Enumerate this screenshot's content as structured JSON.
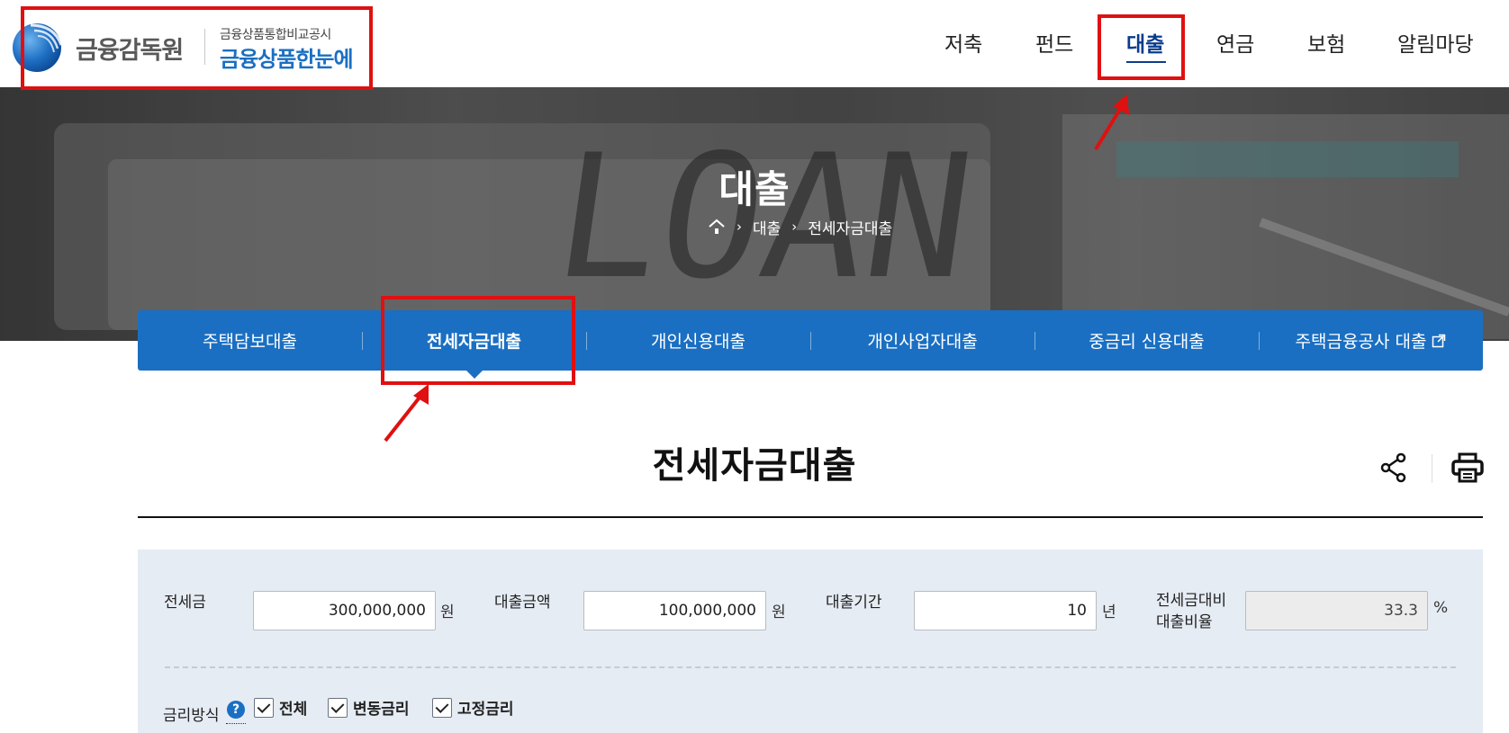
{
  "header": {
    "logo": {
      "org_name": "금융감독원",
      "sub_title": "금융상품통합비교공시",
      "main_title": "금융상품한눈에"
    },
    "nav": [
      {
        "label": "저축",
        "active": false
      },
      {
        "label": "펀드",
        "active": false
      },
      {
        "label": "대출",
        "active": true
      },
      {
        "label": "연금",
        "active": false
      },
      {
        "label": "보험",
        "active": false
      },
      {
        "label": "알림마당",
        "active": false
      }
    ]
  },
  "hero": {
    "title": "대출",
    "breadcrumb": {
      "home_icon": "home-icon",
      "items": [
        "대출",
        "전세자금대출"
      ]
    }
  },
  "subtabs": [
    {
      "label": "주택담보대출",
      "active": false
    },
    {
      "label": "전세자금대출",
      "active": true
    },
    {
      "label": "개인신용대출",
      "active": false
    },
    {
      "label": "개인사업자대출",
      "active": false
    },
    {
      "label": "중금리 신용대출",
      "active": false
    },
    {
      "label": "주택금융공사 대출",
      "active": false,
      "icon": "external-link-icon"
    }
  ],
  "page": {
    "title": "전세자금대출",
    "share_icon": "share-icon",
    "print_icon": "print-icon"
  },
  "form": {
    "jeonse": {
      "label": "전세금",
      "value": "300,000,000",
      "unit": "원"
    },
    "loan_amount": {
      "label": "대출금액",
      "value": "100,000,000",
      "unit": "원"
    },
    "loan_period": {
      "label": "대출기간",
      "value": "10",
      "unit": "년"
    },
    "ratio": {
      "label_line1": "전세금대비",
      "label_line2": "대출비율",
      "value": "33.3",
      "unit": "%"
    },
    "rate_type": {
      "label": "금리방식",
      "help": "?",
      "options": [
        {
          "label": "전체",
          "checked": true
        },
        {
          "label": "변동금리",
          "checked": true
        },
        {
          "label": "고정금리",
          "checked": true
        }
      ]
    }
  },
  "colors": {
    "brand_blue": "#1a6fc2",
    "nav_active": "#0a3c8c",
    "annotation_red": "#e01010",
    "form_bg": "#e6ecf4"
  }
}
